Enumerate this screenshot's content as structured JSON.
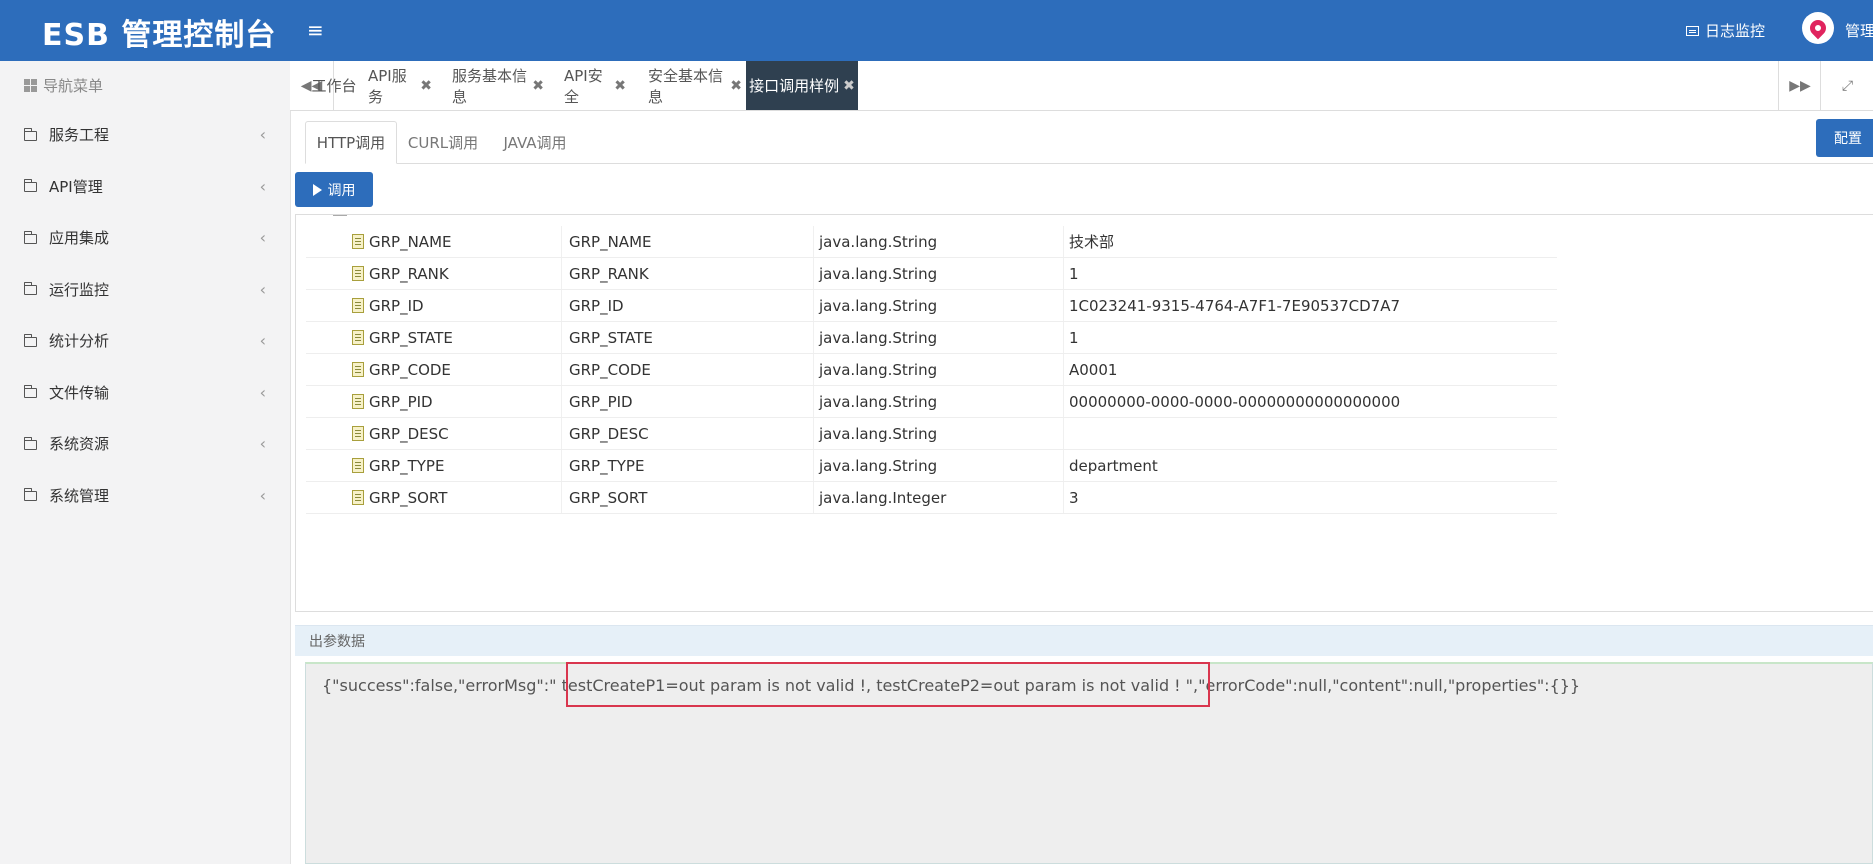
{
  "header": {
    "brand": "ESB 管理控制台",
    "menu_toggle": "≡",
    "log_monitor": "日志监控",
    "user": "管理"
  },
  "sidebar": {
    "title": "导航菜单",
    "items": [
      {
        "label": "服务工程"
      },
      {
        "label": "API管理"
      },
      {
        "label": "应用集成"
      },
      {
        "label": "运行监控"
      },
      {
        "label": "统计分析"
      },
      {
        "label": "文件传输"
      },
      {
        "label": "系统资源"
      },
      {
        "label": "系统管理"
      }
    ]
  },
  "tabs": [
    {
      "label": "工作台",
      "closable": false
    },
    {
      "label": "API服务",
      "closable": true
    },
    {
      "label": "服务基本信息",
      "closable": true
    },
    {
      "label": "API安全",
      "closable": true
    },
    {
      "label": "安全基本信息",
      "closable": true
    },
    {
      "label": "接口调用样例",
      "closable": true,
      "active": true
    }
  ],
  "close_symbol": "✖",
  "subtabs": [
    {
      "label": "HTTP调用",
      "active": true
    },
    {
      "label": "CURL调用"
    },
    {
      "label": "JAVA调用"
    }
  ],
  "config_button": "配置",
  "call_button": "调用",
  "table_rows": [
    [
      "GRP_NAME",
      "GRP_NAME",
      "java.lang.String",
      "技术部"
    ],
    [
      "GRP_RANK",
      "GRP_RANK",
      "java.lang.String",
      "1"
    ],
    [
      "GRP_ID",
      "GRP_ID",
      "java.lang.String",
      "1C023241-9315-4764-A7F1-7E90537CD7A7"
    ],
    [
      "GRP_STATE",
      "GRP_STATE",
      "java.lang.String",
      "1"
    ],
    [
      "GRP_CODE",
      "GRP_CODE",
      "java.lang.String",
      "A0001"
    ],
    [
      "GRP_PID",
      "GRP_PID",
      "java.lang.String",
      "00000000-0000-0000-00000000000000000"
    ],
    [
      "GRP_DESC",
      "GRP_DESC",
      "java.lang.String",
      ""
    ],
    [
      "GRP_TYPE",
      "GRP_TYPE",
      "java.lang.String",
      "department"
    ],
    [
      "GRP_SORT",
      "GRP_SORT",
      "java.lang.Integer",
      "3"
    ]
  ],
  "output": {
    "title": "出参数据",
    "text": "{\"success\":false,\"errorMsg\":\" testCreateP1=out param is not valid !, testCreateP2=out param is not valid ! \",\"errorCode\":null,\"content\":null,\"properties\":{}}"
  },
  "colors": {
    "header_bg": "#2d6dbb",
    "active_tab_bg": "#2f4050",
    "highlight_border": "#d9364e"
  }
}
